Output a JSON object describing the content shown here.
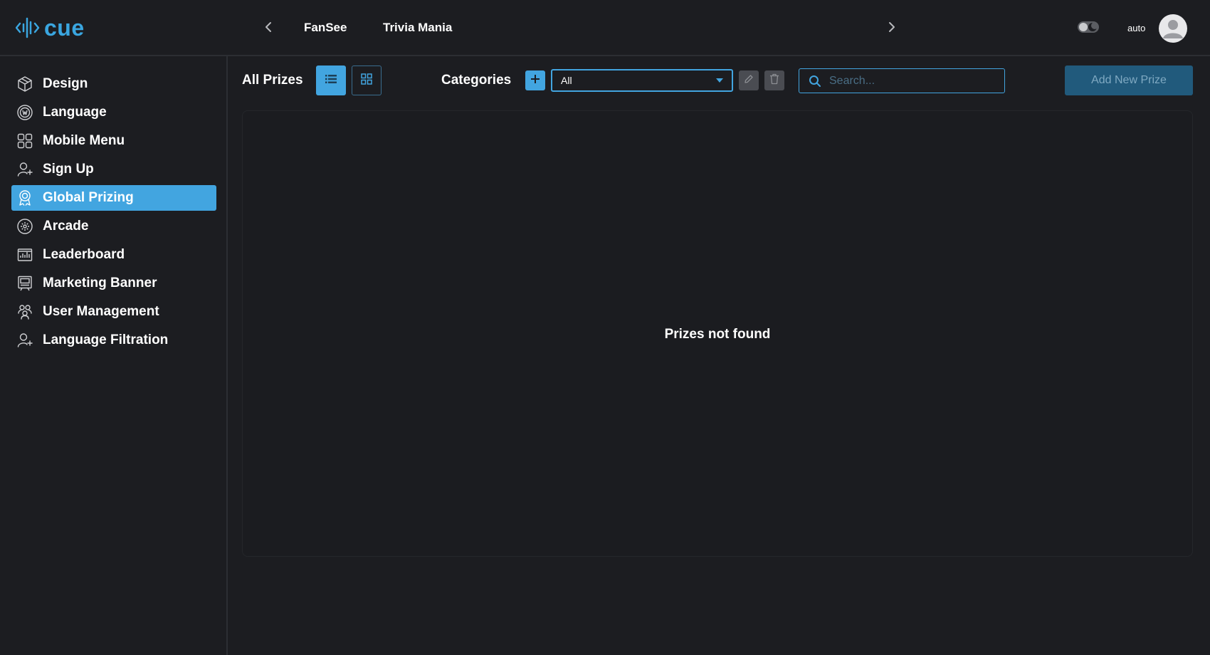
{
  "header": {
    "logo_text": "cue",
    "tabs": [
      {
        "label": "FanSee"
      },
      {
        "label": "Trivia Mania"
      }
    ],
    "theme_mode_label": "auto",
    "icons": {
      "logo": "soundwave-logo-icon",
      "prev": "chevron-left-icon",
      "next": "chevron-right-icon",
      "theme": "theme-toggle-icon",
      "avatar": "user-avatar-icon"
    }
  },
  "sidebar": {
    "items": [
      {
        "label": "Design",
        "icon": "cube-icon",
        "active": false
      },
      {
        "label": "Language",
        "icon": "language-icon",
        "active": false
      },
      {
        "label": "Mobile Menu",
        "icon": "grid-menu-icon",
        "active": false
      },
      {
        "label": "Sign Up",
        "icon": "user-plus-icon",
        "active": false
      },
      {
        "label": "Global Prizing",
        "icon": "award-icon",
        "active": true
      },
      {
        "label": "Arcade",
        "icon": "arcade-icon",
        "active": false
      },
      {
        "label": "Leaderboard",
        "icon": "leaderboard-icon",
        "active": false
      },
      {
        "label": "Marketing Banner",
        "icon": "banner-icon",
        "active": false
      },
      {
        "label": "User Management",
        "icon": "users-icon",
        "active": false
      },
      {
        "label": "Language Filtration",
        "icon": "user-plus-icon",
        "active": false
      }
    ]
  },
  "toolbar": {
    "title": "All Prizes",
    "view_modes": [
      "list",
      "grid"
    ],
    "active_view": "list",
    "categories_label": "Categories",
    "category_selected": "All",
    "search_placeholder": "Search...",
    "search_value": "",
    "add_button_label": "Add New Prize"
  },
  "content": {
    "empty_message": "Prizes not found"
  },
  "colors": {
    "accent": "#42a5e0",
    "background": "#1c1d21",
    "add_prize_button": "#215a7c",
    "logo": "#3aa6e0"
  }
}
